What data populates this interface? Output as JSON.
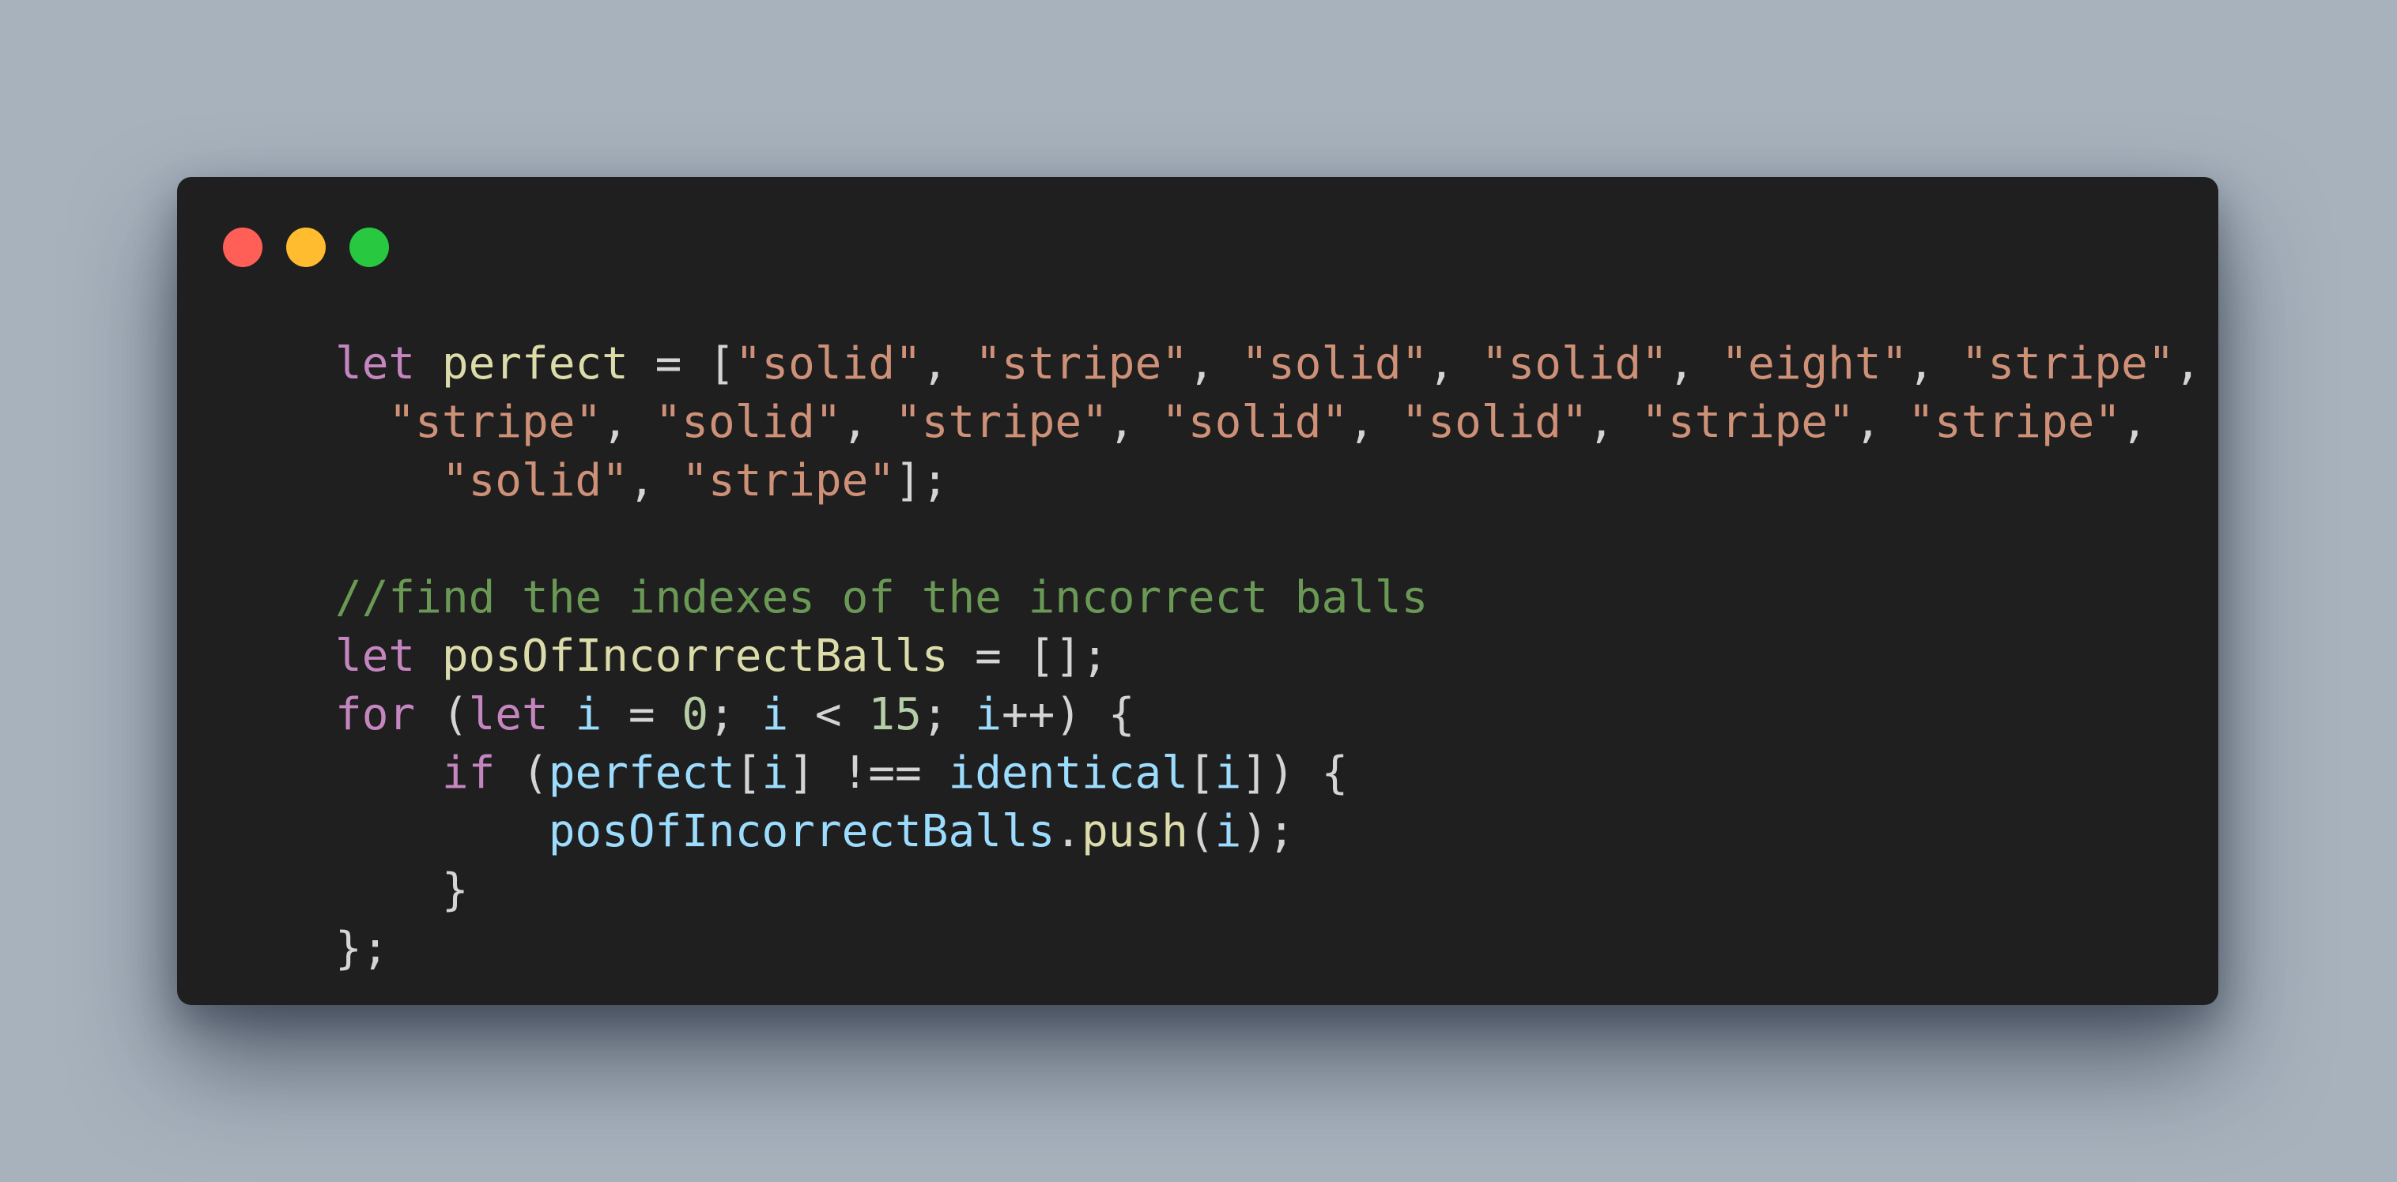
{
  "window": {
    "controls": [
      {
        "name": "close",
        "color": "#ff5f57"
      },
      {
        "name": "minimize",
        "color": "#febc2e"
      },
      {
        "name": "zoom",
        "color": "#28c840"
      }
    ]
  },
  "theme": {
    "keyword": "#c586c0",
    "identifier": "#dcdcaa",
    "variable": "#9cdcfe",
    "string": "#ce9178",
    "number": "#b5cea8",
    "comment": "#6a9955",
    "punctuation": "#d4d4d4",
    "function": "#dcdcaa",
    "background": "#1f1f1f",
    "page_background": "#a7b2bd"
  },
  "code_lines": [
    {
      "indent": "",
      "tokens": [
        {
          "t": "let",
          "c": "keyword"
        },
        {
          "t": " ",
          "c": "punctuation"
        },
        {
          "t": "perfect",
          "c": "identifier"
        },
        {
          "t": " = [",
          "c": "punctuation"
        },
        {
          "t": "\"solid\"",
          "c": "string"
        },
        {
          "t": ", ",
          "c": "punctuation"
        },
        {
          "t": "\"stripe\"",
          "c": "string"
        },
        {
          "t": ", ",
          "c": "punctuation"
        },
        {
          "t": "\"solid\"",
          "c": "string"
        },
        {
          "t": ", ",
          "c": "punctuation"
        },
        {
          "t": "\"solid\"",
          "c": "string"
        },
        {
          "t": ", ",
          "c": "punctuation"
        },
        {
          "t": "\"eight\"",
          "c": "string"
        },
        {
          "t": ", ",
          "c": "punctuation"
        },
        {
          "t": "\"stripe\"",
          "c": "string"
        },
        {
          "t": ",",
          "c": "punctuation"
        }
      ]
    },
    {
      "indent": "  ",
      "tokens": [
        {
          "t": "\"stripe\"",
          "c": "string"
        },
        {
          "t": ", ",
          "c": "punctuation"
        },
        {
          "t": "\"solid\"",
          "c": "string"
        },
        {
          "t": ", ",
          "c": "punctuation"
        },
        {
          "t": "\"stripe\"",
          "c": "string"
        },
        {
          "t": ", ",
          "c": "punctuation"
        },
        {
          "t": "\"solid\"",
          "c": "string"
        },
        {
          "t": ", ",
          "c": "punctuation"
        },
        {
          "t": "\"solid\"",
          "c": "string"
        },
        {
          "t": ", ",
          "c": "punctuation"
        },
        {
          "t": "\"stripe\"",
          "c": "string"
        },
        {
          "t": ", ",
          "c": "punctuation"
        },
        {
          "t": "\"stripe\"",
          "c": "string"
        },
        {
          "t": ",",
          "c": "punctuation"
        }
      ]
    },
    {
      "indent": "    ",
      "tokens": [
        {
          "t": "\"solid\"",
          "c": "string"
        },
        {
          "t": ", ",
          "c": "punctuation"
        },
        {
          "t": "\"stripe\"",
          "c": "string"
        },
        {
          "t": "];",
          "c": "punctuation"
        }
      ]
    },
    {
      "indent": "",
      "tokens": []
    },
    {
      "indent": "",
      "tokens": [
        {
          "t": "//find the indexes of the incorrect balls",
          "c": "comment"
        }
      ]
    },
    {
      "indent": "",
      "tokens": [
        {
          "t": "let",
          "c": "keyword"
        },
        {
          "t": " ",
          "c": "punctuation"
        },
        {
          "t": "posOfIncorrectBalls",
          "c": "identifier"
        },
        {
          "t": " = [];",
          "c": "punctuation"
        }
      ]
    },
    {
      "indent": "",
      "tokens": [
        {
          "t": "for",
          "c": "keyword"
        },
        {
          "t": " (",
          "c": "punctuation"
        },
        {
          "t": "let",
          "c": "keyword"
        },
        {
          "t": " ",
          "c": "punctuation"
        },
        {
          "t": "i",
          "c": "variable"
        },
        {
          "t": " = ",
          "c": "punctuation"
        },
        {
          "t": "0",
          "c": "number"
        },
        {
          "t": "; ",
          "c": "punctuation"
        },
        {
          "t": "i",
          "c": "variable"
        },
        {
          "t": " < ",
          "c": "punctuation"
        },
        {
          "t": "15",
          "c": "number"
        },
        {
          "t": "; ",
          "c": "punctuation"
        },
        {
          "t": "i",
          "c": "variable"
        },
        {
          "t": "++) {",
          "c": "punctuation"
        }
      ]
    },
    {
      "indent": "    ",
      "tokens": [
        {
          "t": "if",
          "c": "keyword"
        },
        {
          "t": " (",
          "c": "punctuation"
        },
        {
          "t": "perfect",
          "c": "variable"
        },
        {
          "t": "[",
          "c": "punctuation"
        },
        {
          "t": "i",
          "c": "variable"
        },
        {
          "t": "] !== ",
          "c": "punctuation"
        },
        {
          "t": "identical",
          "c": "variable"
        },
        {
          "t": "[",
          "c": "punctuation"
        },
        {
          "t": "i",
          "c": "variable"
        },
        {
          "t": "]) {",
          "c": "punctuation"
        }
      ]
    },
    {
      "indent": "        ",
      "tokens": [
        {
          "t": "posOfIncorrectBalls",
          "c": "variable"
        },
        {
          "t": ".",
          "c": "punctuation"
        },
        {
          "t": "push",
          "c": "function"
        },
        {
          "t": "(",
          "c": "punctuation"
        },
        {
          "t": "i",
          "c": "variable"
        },
        {
          "t": ");",
          "c": "punctuation"
        }
      ]
    },
    {
      "indent": "    ",
      "tokens": [
        {
          "t": "}",
          "c": "punctuation"
        }
      ]
    },
    {
      "indent": "",
      "tokens": [
        {
          "t": "};",
          "c": "punctuation"
        }
      ]
    }
  ]
}
